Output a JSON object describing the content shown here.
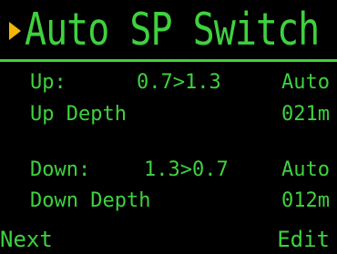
{
  "title": "Auto SP Switch",
  "colors": {
    "text": "#3fd13f",
    "background": "#000000",
    "pointer": "#f2b800"
  },
  "rows": [
    {
      "label": "Up:",
      "value": "0.7>1.3",
      "mode": "Auto"
    },
    {
      "label": "Up Depth",
      "value": "",
      "mode": "021m"
    },
    {
      "label": "Down:",
      "value": "1.3>0.7",
      "mode": "Auto"
    },
    {
      "label": "Down Depth",
      "value": "",
      "mode": "012m"
    }
  ],
  "softkeys": {
    "left": "Next",
    "right": "Edit"
  }
}
